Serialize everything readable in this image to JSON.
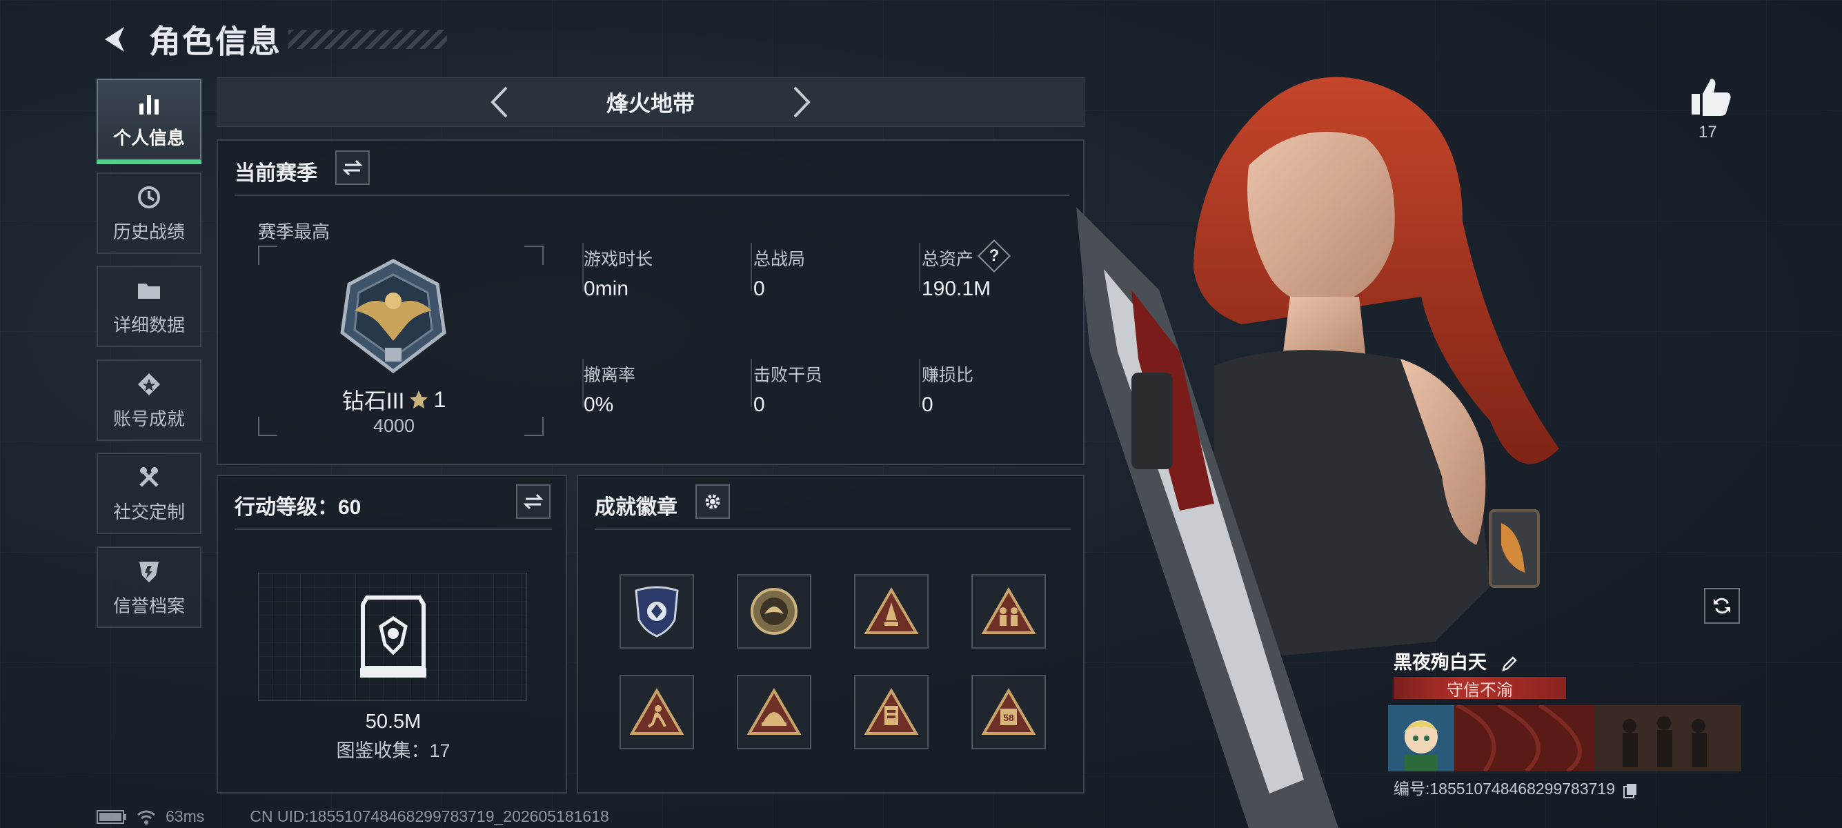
{
  "header": {
    "title": "角色信息"
  },
  "sidebar": {
    "items": [
      {
        "label": "个人信息",
        "icon": "bar-chart-icon",
        "active": true
      },
      {
        "label": "历史战绩",
        "icon": "history-clock-icon"
      },
      {
        "label": "详细数据",
        "icon": "folder-icon"
      },
      {
        "label": "账号成就",
        "icon": "achievement-star-icon"
      },
      {
        "label": "社交定制",
        "icon": "tools-icon"
      },
      {
        "label": "信誉档案",
        "icon": "credit-shield-icon"
      }
    ]
  },
  "mode_selector": {
    "current": "烽火地带"
  },
  "season": {
    "title": "当前赛季",
    "best_label": "赛季最高",
    "rank_name": "钻石III",
    "rank_stars": "1",
    "rank_points": "4000",
    "stats": [
      {
        "label": "游戏时长",
        "value": "0min"
      },
      {
        "label": "总战局",
        "value": "0"
      },
      {
        "label": "总资产",
        "value": "190.1M",
        "help": "?"
      },
      {
        "label": "撤离率",
        "value": "0%"
      },
      {
        "label": "击败干员",
        "value": "0"
      },
      {
        "label": "赚损比",
        "value": "0"
      }
    ]
  },
  "action_level": {
    "title": "行动等级：60",
    "value_text": "50.5M",
    "collection": "图鉴收集：17"
  },
  "achievements": {
    "title": "成就徽章",
    "badges": [
      "shield-badge-icon",
      "coin-badge-icon",
      "triangle-rocket-badge-icon",
      "triangle-soldiers-badge-icon",
      "triangle-runner-badge-icon",
      "triangle-helmet-badge-icon",
      "triangle-card-badge-icon",
      "triangle-58-badge-icon"
    ],
    "badge_58": "58"
  },
  "player": {
    "likes": "17",
    "name": "黑夜殉白天",
    "tag": "守信不渝",
    "id_line": "编号:185510748468299783719"
  },
  "status_bar": {
    "ping": "63ms",
    "uid": "CN UID:185510748468299783719_202605181618"
  },
  "colors": {
    "accent_green": "#4fd38a",
    "tag_red": "#b3302a",
    "hair": "#b63a22"
  }
}
